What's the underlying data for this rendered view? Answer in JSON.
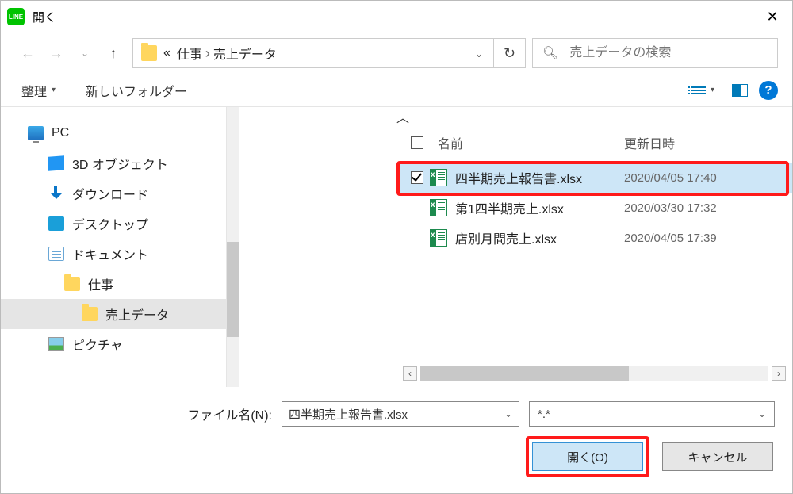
{
  "title": "開く",
  "breadcrumb": {
    "pre": "«",
    "seg1": "仕事",
    "seg2": "売上データ"
  },
  "search_placeholder": "売上データの検索",
  "toolbar": {
    "organize": "整理",
    "newfolder": "新しいフォルダー"
  },
  "sidebar": {
    "pc": "PC",
    "obj3d": "3D オブジェクト",
    "downloads": "ダウンロード",
    "desktop": "デスクトップ",
    "documents": "ドキュメント",
    "work": "仕事",
    "sales": "売上データ",
    "pictures": "ピクチャ"
  },
  "columns": {
    "name": "名前",
    "date": "更新日時"
  },
  "files": [
    {
      "name": "四半期売上報告書.xlsx",
      "date": "2020/04/05 17:40",
      "selected": true
    },
    {
      "name": "第1四半期売上.xlsx",
      "date": "2020/03/30 17:32",
      "selected": false
    },
    {
      "name": "店別月間売上.xlsx",
      "date": "2020/04/05 17:39",
      "selected": false
    }
  ],
  "footer": {
    "fname_label": "ファイル名(N):",
    "fname_value": "四半期売上報告書.xlsx",
    "filter_value": "*.*",
    "open_label": "開く(O)",
    "cancel_label": "キャンセル"
  }
}
